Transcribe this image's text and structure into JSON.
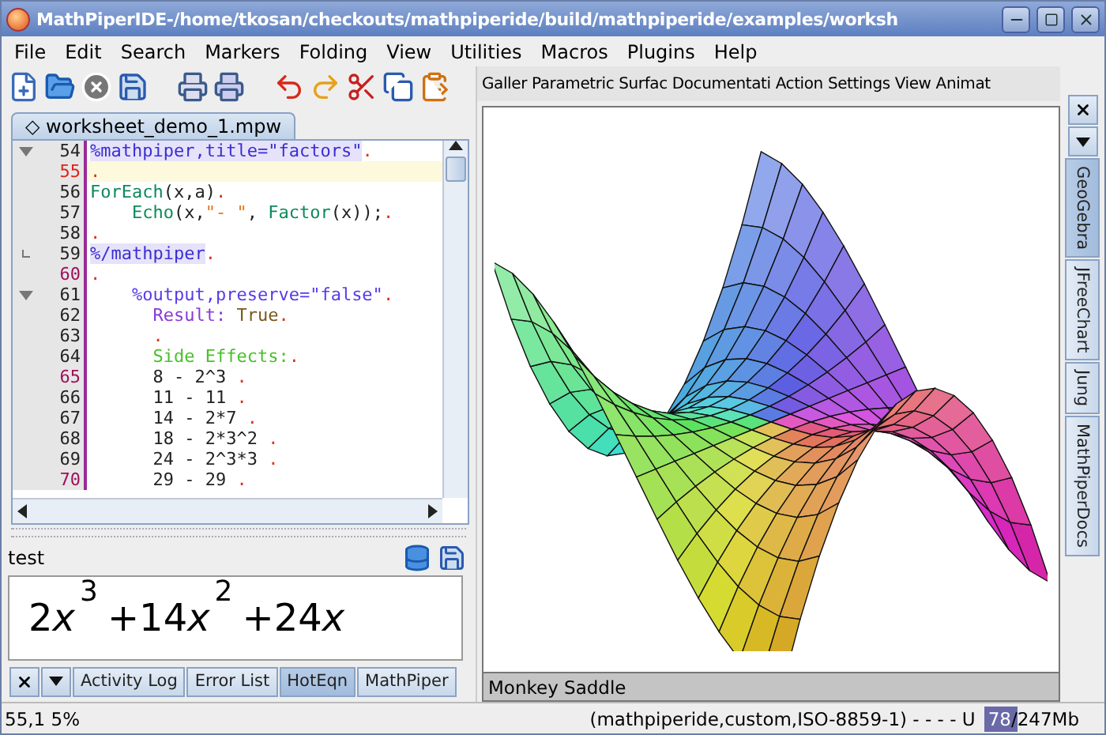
{
  "window": {
    "title": "MathPiperIDE-/home/tkosan/checkouts/mathpiperide/build/mathpiperide/examples/worksh"
  },
  "menu": [
    "File",
    "Edit",
    "Search",
    "Markers",
    "Folding",
    "View",
    "Utilities",
    "Macros",
    "Plugins",
    "Help"
  ],
  "editor": {
    "tab": "◇ worksheet_demo_1.mpw",
    "lines": [
      {
        "number": "54",
        "kind": "foldstart",
        "current": false,
        "accent": false,
        "segments": [
          {
            "kind": "markup",
            "text": "%mathpiper,title=\"factors\""
          },
          {
            "kind": "eol",
            "text": "."
          }
        ]
      },
      {
        "number": "55",
        "kind": "plain",
        "current": true,
        "accent": true,
        "segments": [
          {
            "kind": "eol",
            "text": "."
          }
        ]
      },
      {
        "number": "56",
        "kind": "plain",
        "current": false,
        "accent": false,
        "segments": [
          {
            "kind": "keyword",
            "text": "ForEach"
          },
          {
            "kind": "plain",
            "text": "(x,a)"
          },
          {
            "kind": "eol",
            "text": "."
          }
        ]
      },
      {
        "number": "57",
        "kind": "plain",
        "current": false,
        "accent": false,
        "segments": [
          {
            "kind": "keyword",
            "text": "    Echo"
          },
          {
            "kind": "plain",
            "text": "(x,"
          },
          {
            "kind": "string",
            "text": "\"- \""
          },
          {
            "kind": "plain",
            "text": ", "
          },
          {
            "kind": "keyword",
            "text": "Factor"
          },
          {
            "kind": "plain",
            "text": "(x));"
          },
          {
            "kind": "eol",
            "text": "."
          }
        ]
      },
      {
        "number": "58",
        "kind": "plain",
        "current": false,
        "accent": false,
        "segments": [
          {
            "kind": "eol",
            "text": "."
          }
        ]
      },
      {
        "number": "59",
        "kind": "foldend",
        "current": false,
        "accent": false,
        "segments": [
          {
            "kind": "markup",
            "text": "%/mathpiper"
          },
          {
            "kind": "eol",
            "text": "."
          }
        ]
      },
      {
        "number": "60",
        "kind": "plain",
        "current": false,
        "accent": true,
        "segments": [
          {
            "kind": "eol",
            "text": "."
          }
        ]
      },
      {
        "number": "61",
        "kind": "foldstart",
        "current": false,
        "accent": false,
        "segments": [
          {
            "kind": "tag",
            "text": "    %output,preserve=\"false\""
          },
          {
            "kind": "eol",
            "text": "."
          }
        ]
      },
      {
        "number": "62",
        "kind": "plain",
        "current": false,
        "accent": false,
        "segments": [
          {
            "kind": "result",
            "text": "      Result: "
          },
          {
            "kind": "value",
            "text": "True"
          },
          {
            "kind": "eol",
            "text": "."
          }
        ]
      },
      {
        "number": "63",
        "kind": "plain",
        "current": false,
        "accent": false,
        "segments": [
          {
            "kind": "eol",
            "text": "      ."
          }
        ]
      },
      {
        "number": "64",
        "kind": "plain",
        "current": false,
        "accent": false,
        "segments": [
          {
            "kind": "side",
            "text": "      Side Effects:"
          },
          {
            "kind": "eol",
            "text": "."
          }
        ]
      },
      {
        "number": "65",
        "kind": "plain",
        "current": false,
        "accent": true,
        "segments": [
          {
            "kind": "plain",
            "text": "      8 - 2^3 "
          },
          {
            "kind": "eol",
            "text": "."
          }
        ]
      },
      {
        "number": "66",
        "kind": "plain",
        "current": false,
        "accent": false,
        "segments": [
          {
            "kind": "plain",
            "text": "      11 - 11 "
          },
          {
            "kind": "eol",
            "text": "."
          }
        ]
      },
      {
        "number": "67",
        "kind": "plain",
        "current": false,
        "accent": false,
        "segments": [
          {
            "kind": "plain",
            "text": "      14 - 2*7 "
          },
          {
            "kind": "eol",
            "text": "."
          }
        ]
      },
      {
        "number": "68",
        "kind": "plain",
        "current": false,
        "accent": false,
        "segments": [
          {
            "kind": "plain",
            "text": "      18 - 2*3^2 "
          },
          {
            "kind": "eol",
            "text": "."
          }
        ]
      },
      {
        "number": "69",
        "kind": "plain",
        "current": false,
        "accent": false,
        "segments": [
          {
            "kind": "plain",
            "text": "      24 - 2^3*3 "
          },
          {
            "kind": "eol",
            "text": "."
          }
        ]
      },
      {
        "number": "70",
        "kind": "plain",
        "current": false,
        "accent": true,
        "segments": [
          {
            "kind": "plain",
            "text": "      29 - 29 "
          },
          {
            "kind": "eol",
            "text": "."
          }
        ]
      }
    ]
  },
  "output_panel": {
    "label": "test",
    "equation": [
      {
        "coef": "2",
        "var": "x",
        "power": "3"
      },
      {
        "coef": "+14",
        "var": "x",
        "power": "2"
      },
      {
        "coef": "+24",
        "var": "x"
      }
    ],
    "tabs": [
      {
        "label": "Activity Log",
        "selected": false
      },
      {
        "label": "Error List",
        "selected": false
      },
      {
        "label": "HotEqn",
        "selected": true
      },
      {
        "label": "MathPiper",
        "selected": false
      }
    ]
  },
  "plot_panel": {
    "tabs": [
      "Galler",
      "Parametric Surfac",
      "Documentati",
      "Action",
      "Settings",
      "View",
      "Animat"
    ],
    "caption": "Monkey Saddle"
  },
  "side_tabs": [
    {
      "label": "GeoGebra",
      "selected": true
    },
    {
      "label": "JFreeChart",
      "selected": false
    },
    {
      "label": "Jung",
      "selected": false
    },
    {
      "label": "MathPiperDocs",
      "selected": false
    }
  ],
  "status_bar": {
    "position": "55,1 5%",
    "mode": "(mathpiperide,custom,ISO-8859-1) - - - - U",
    "memory": {
      "used": "78",
      "total": "/247Mb",
      "level": 0.32
    }
  }
}
